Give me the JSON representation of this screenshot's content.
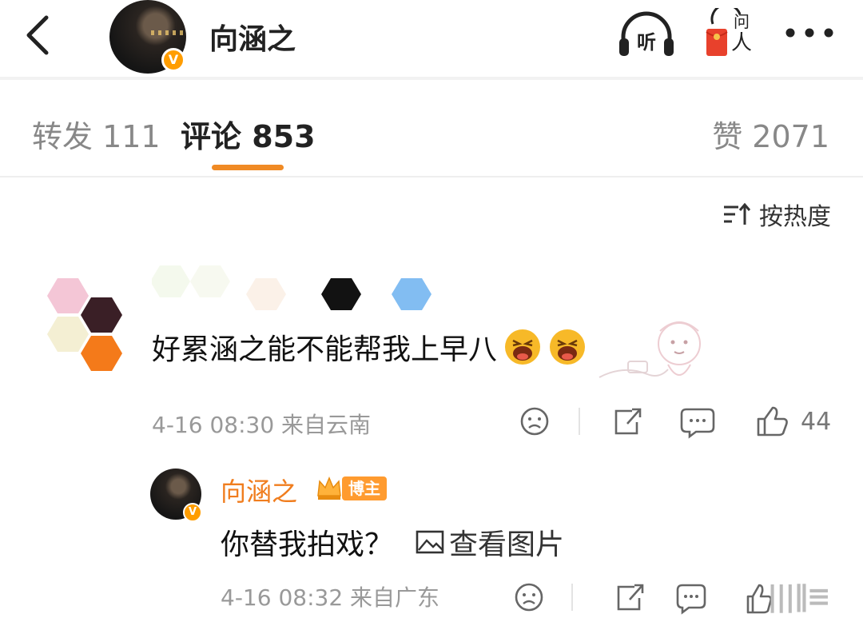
{
  "header": {
    "title": "向涵之",
    "verified_badge": "V",
    "listen_label": "听",
    "ask_label": "问人",
    "icons": [
      "back-arrow-icon",
      "headphones-icon",
      "red-envelope-icon",
      "more-dots-icon"
    ]
  },
  "tabs": {
    "repost": "转发 111",
    "comment": "评论 853",
    "like": "赞 2071",
    "accent_color": "#f08a24"
  },
  "sort": {
    "label": "按热度"
  },
  "comment": {
    "text": "好累涵之能不能帮我上早八",
    "meta": "4-16 08:30 来自云南",
    "like_count": "44"
  },
  "reply": {
    "name": "向涵之",
    "role_badge": "博主",
    "text": "你替我拍戏？",
    "image_link": "查看图片",
    "meta": "4-16 08:32 来自广东",
    "name_color": "#f07d1e"
  }
}
